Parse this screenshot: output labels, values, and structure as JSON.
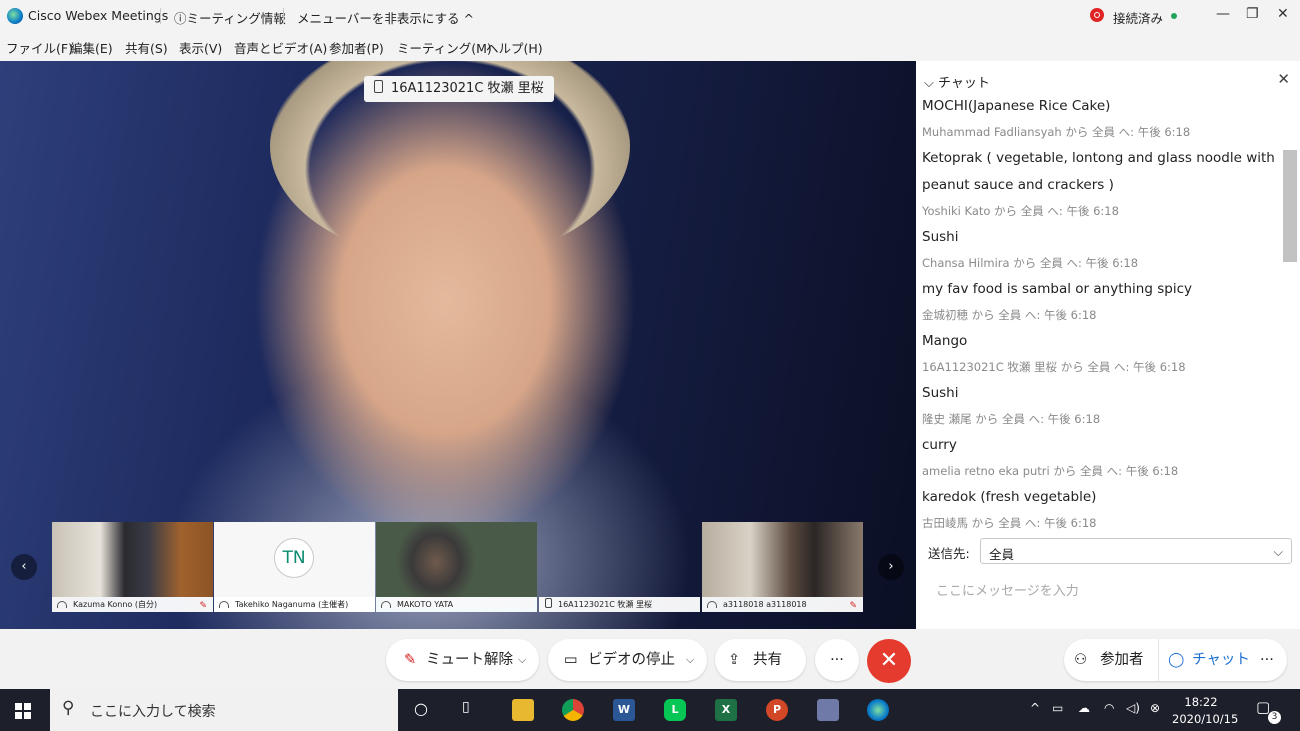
{
  "titlebar": {
    "app_name": "Cisco Webex Meetings",
    "meeting_info": "ミーティング情報",
    "hide_menu": "メニューバーを非表示にする ^",
    "status": "接続済み"
  },
  "menu": [
    "ファイル(F)",
    "編集(E)",
    "共有(S)",
    "表示(V)",
    "音声とビデオ(A)",
    "参加者(P)",
    "ミーティング(M)",
    "ヘルプ(H)"
  ],
  "video": {
    "speaker": "16A1123021C 牧瀬 里桜"
  },
  "thumbnails": [
    {
      "name": "Kazuma Konno",
      "suffix": "(自分)"
    },
    {
      "initials": "TN",
      "name": "Takehiko Naganuma",
      "suffix": "(主催者)"
    },
    {
      "name": "MAKOTO YATA"
    },
    {
      "name": "16A1123021C 牧瀬 里桜"
    },
    {
      "name": "a3118018 a3118018"
    }
  ],
  "chat": {
    "title": "チャット",
    "messages": [
      {
        "text": "MOCHI(Japanese Rice Cake)"
      },
      {
        "meta": "Muhammad Fadliansyah から 全員 へ:   午後 6:18",
        "text": "Ketoprak ( vegetable, lontong and glass noodle with peanut sauce and crackers )"
      },
      {
        "meta": "Yoshiki Kato から 全員 へ:   午後 6:18",
        "text": "Sushi"
      },
      {
        "meta": "Chansa Hilmira から 全員 へ:   午後 6:18",
        "text": "my fav food is sambal or anything spicy"
      },
      {
        "meta": "金城初穂 から 全員 へ:   午後 6:18",
        "text": "Mango"
      },
      {
        "meta": "16A1123021C 牧瀬 里桜 から 全員 へ:   午後 6:18",
        "text": "Sushi"
      },
      {
        "meta": "隆史 瀬尾 から 全員 へ:   午後 6:18",
        "text": "curry"
      },
      {
        "meta": "amelia retno eka putri から 全員 へ:   午後 6:18",
        "text": "karedok (fresh vegetable)"
      },
      {
        "meta": "古田崚馬 から 全員 へ:   午後 6:18"
      }
    ],
    "send_to_label": "送信先:",
    "send_to_value": "全員",
    "input_placeholder": "ここにメッセージを入力"
  },
  "controls": {
    "unmute": "ミュート解除",
    "stop_video": "ビデオの停止",
    "share": "共有",
    "more": "···",
    "participants": "参加者",
    "chat": "チャット"
  },
  "taskbar": {
    "search_placeholder": "ここに入力して検索",
    "time": "18:22",
    "date": "2020/10/15",
    "notification_count": "3"
  },
  "colors": {
    "accent": "#1aa0e0",
    "end_call": "#e53b2e",
    "status_green": "#23a35a",
    "recording_red": "#e02424"
  }
}
